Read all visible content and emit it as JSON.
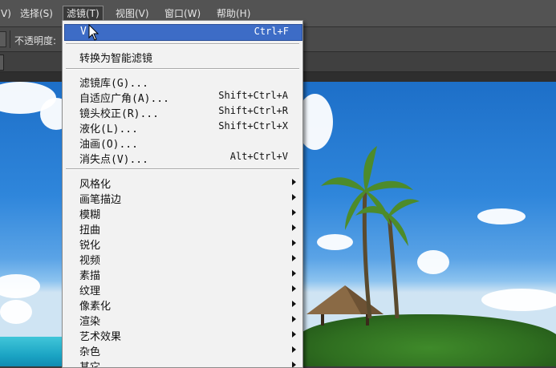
{
  "menubar": {
    "items": [
      {
        "label": "V)"
      },
      {
        "label": "选择(S)"
      },
      {
        "label": "滤镜(T)"
      },
      {
        "label": "视图(V)"
      },
      {
        "label": "窗口(W)"
      },
      {
        "label": "帮助(H)"
      }
    ]
  },
  "options_bar": {
    "opacity_label": "不透明度:"
  },
  "filter_menu": {
    "last_filter": {
      "label": "V",
      "shortcut": "Ctrl+F"
    },
    "convert_smart": {
      "label": "转换为智能滤镜"
    },
    "group2": [
      {
        "label": "滤镜库(G)...",
        "shortcut": ""
      },
      {
        "label": "自适应广角(A)...",
        "shortcut": "Shift+Ctrl+A"
      },
      {
        "label": "镜头校正(R)...",
        "shortcut": "Shift+Ctrl+R"
      },
      {
        "label": "液化(L)...",
        "shortcut": "Shift+Ctrl+X"
      },
      {
        "label": "油画(O)...",
        "shortcut": ""
      },
      {
        "label": "消失点(V)...",
        "shortcut": "Alt+Ctrl+V"
      }
    ],
    "submenus": [
      {
        "label": "风格化"
      },
      {
        "label": "画笔描边"
      },
      {
        "label": "模糊"
      },
      {
        "label": "扭曲"
      },
      {
        "label": "锐化"
      },
      {
        "label": "视频"
      },
      {
        "label": "素描"
      },
      {
        "label": "纹理"
      },
      {
        "label": "像素化"
      },
      {
        "label": "渲染"
      },
      {
        "label": "艺术效果"
      },
      {
        "label": "杂色"
      },
      {
        "label": "其它"
      }
    ]
  },
  "colors": {
    "menu_highlight": "#3d6cc6",
    "menubar_bg": "#535353"
  }
}
